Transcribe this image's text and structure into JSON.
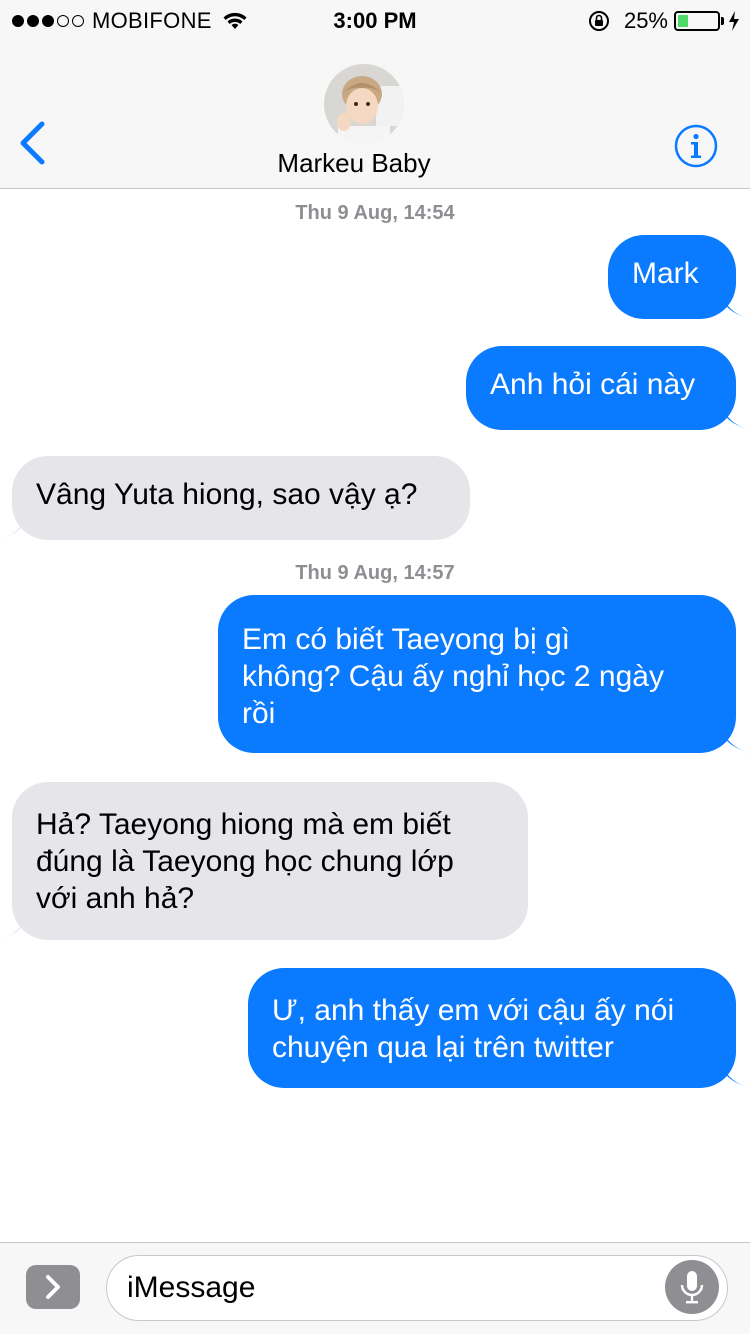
{
  "status_bar": {
    "signal_bars_filled": 3,
    "signal_bars_total": 5,
    "carrier": "MOBIFONE",
    "time": "3:00 PM",
    "battery_pct_label": "25%",
    "battery_level": 0.25,
    "battery_color": "#4cd964"
  },
  "header": {
    "contact_name": "Markeu Baby",
    "avatar": "contact-avatar-photo",
    "back_icon": "chevron-left-icon",
    "info_icon": "info-icon"
  },
  "conversation": {
    "timestamps": [
      "Thu 9 Aug, 14:54",
      "Thu 9 Aug, 14:57"
    ],
    "messages": [
      {
        "direction": "sent",
        "lines": [
          "Mark"
        ]
      },
      {
        "direction": "sent",
        "lines": [
          "Anh hỏi cái này"
        ]
      },
      {
        "direction": "received",
        "lines": [
          "Vâng Yuta hiong, sao vậy ạ?"
        ]
      },
      {
        "direction": "sent",
        "lines": [
          "Em có biết Taeyong bị gì",
          "không? Cậu ấy nghỉ học 2 ngày",
          "rồi"
        ]
      },
      {
        "direction": "received",
        "lines": [
          "Hả? Taeyong hiong mà em biết",
          "đúng là Taeyong học chung lớp",
          "với anh hả?"
        ]
      },
      {
        "direction": "sent",
        "lines": [
          "Ư, anh thấy em với cậu ấy nói",
          "chuyện qua lại trên twitter"
        ]
      }
    ]
  },
  "input_bar": {
    "placeholder": "iMessage",
    "apps_icon": "chevron-right-icon",
    "mic_icon": "microphone-icon"
  },
  "colors": {
    "accent": "#0a7aff",
    "sent_bubble": "#0a7aff",
    "received_bubble": "#e5e5ea",
    "timestamp": "#8e8e93",
    "bar_background": "#f7f7f7"
  }
}
